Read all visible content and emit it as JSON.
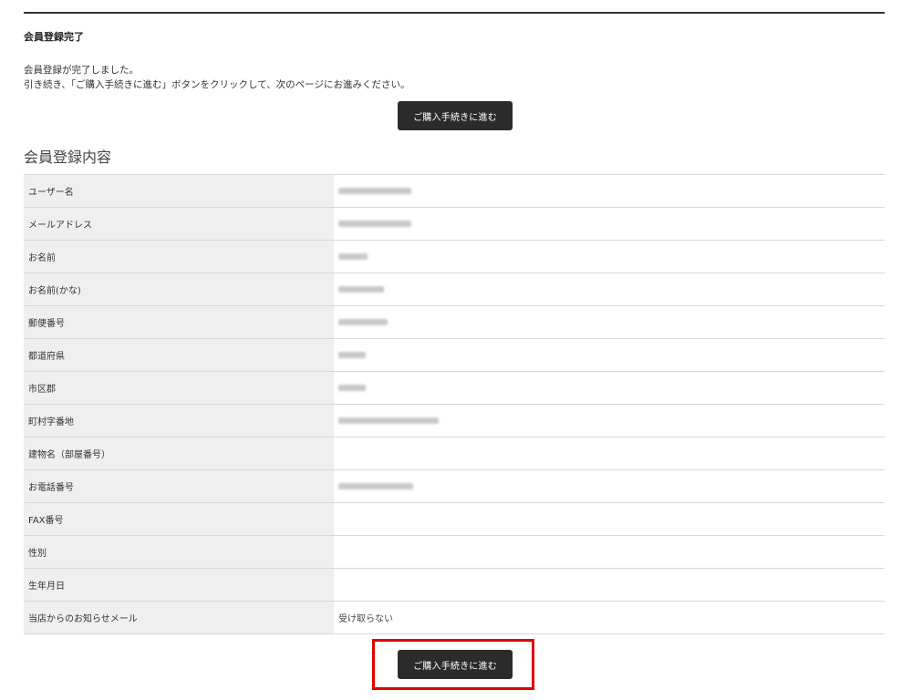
{
  "complete": {
    "heading": "会員登録完了",
    "line1": "会員登録が完了しました。",
    "line2": "引き続き、「ご購入手続きに進む」ボタンをクリックして、次のページにお進みください。",
    "button_label": "ご購入手続きに進む"
  },
  "details": {
    "title": "会員登録内容",
    "rows": [
      {
        "label": "ユーザー名",
        "value": ""
      },
      {
        "label": "メールアドレス",
        "value": ""
      },
      {
        "label": "お名前",
        "value": ""
      },
      {
        "label": "お名前(かな)",
        "value": ""
      },
      {
        "label": "郵便番号",
        "value": ""
      },
      {
        "label": "都道府県",
        "value": ""
      },
      {
        "label": "市区郡",
        "value": ""
      },
      {
        "label": "町村字番地",
        "value": ""
      },
      {
        "label": "建物名（部屋番号）",
        "value": ""
      },
      {
        "label": "お電話番号",
        "value": ""
      },
      {
        "label": "FAX番号",
        "value": ""
      },
      {
        "label": "性別",
        "value": ""
      },
      {
        "label": "生年月日",
        "value": ""
      },
      {
        "label": "当店からのお知らせメール",
        "value": "受け取らない"
      }
    ]
  },
  "footer": {
    "button_label": "ご購入手続きに進む",
    "highlight_color": "#e00000"
  }
}
